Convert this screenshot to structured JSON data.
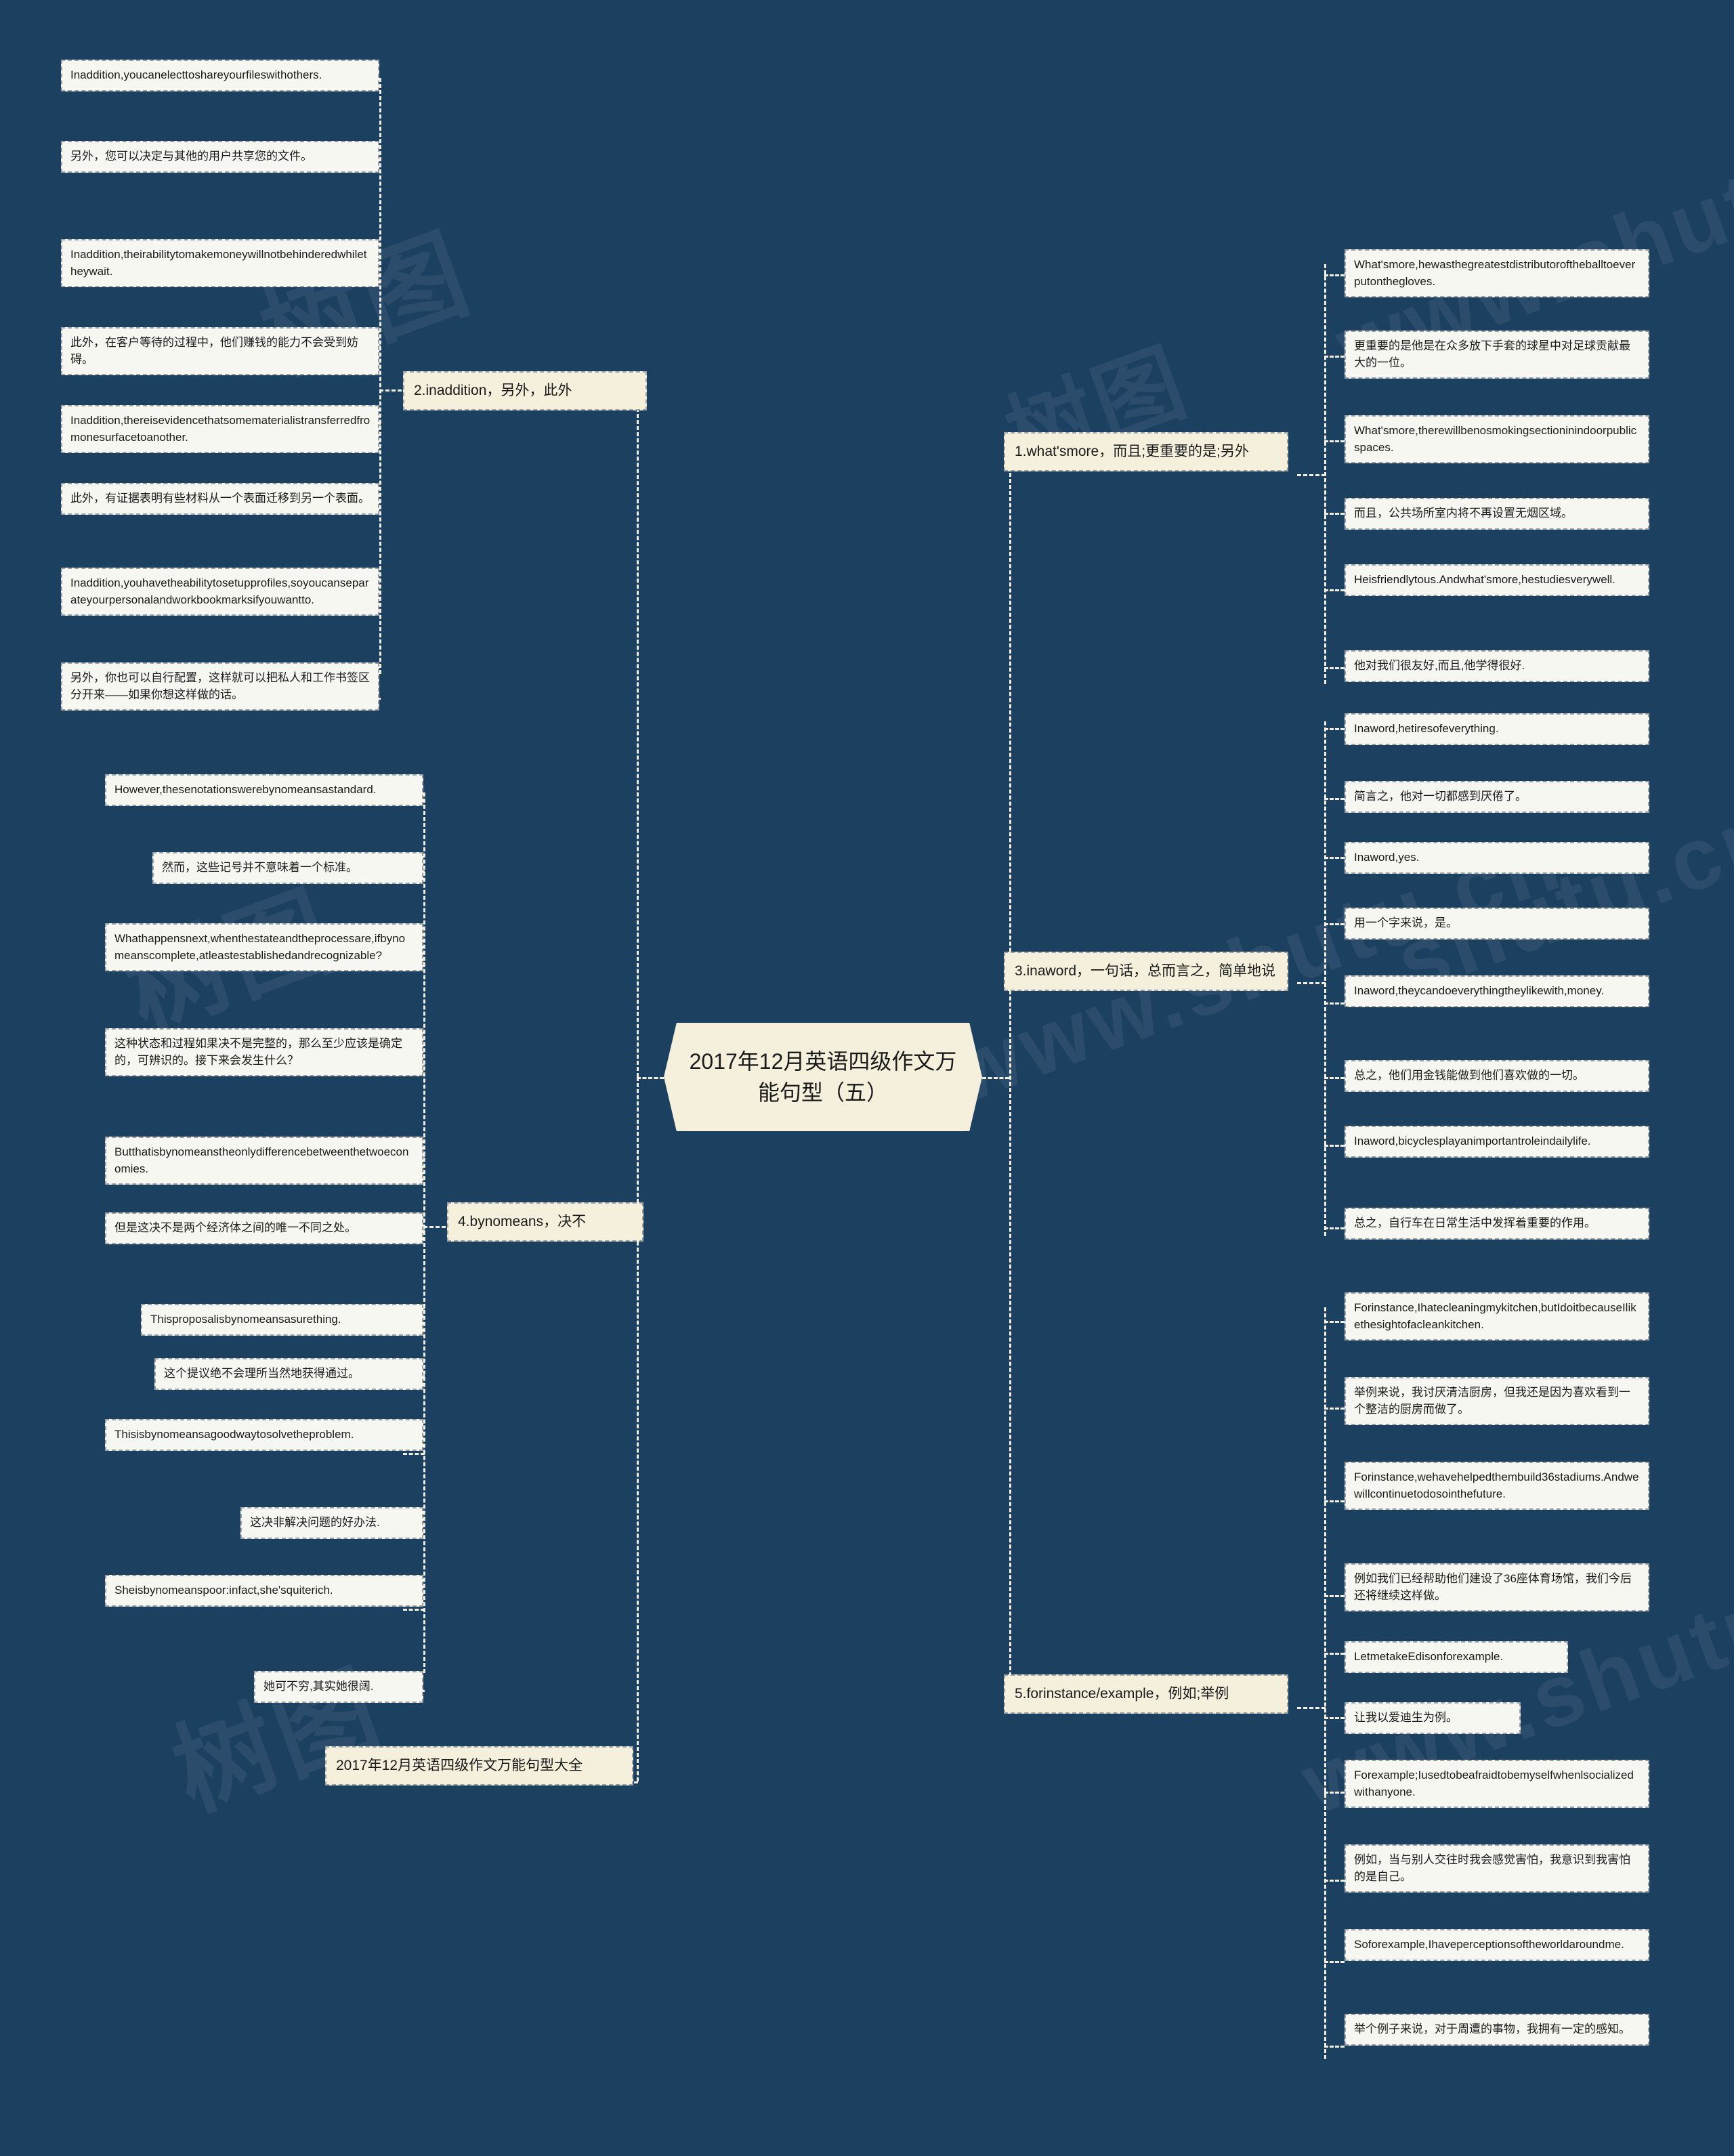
{
  "theme": {
    "background": "#1b4060",
    "node_fill": "#f7f7f2",
    "branch_fill": "#f4f0dc",
    "border": "#9aa0a6",
    "text": "#1a1a1a"
  },
  "center": {
    "title": "2017年12月英语四级作文万能句型（五）"
  },
  "watermarks": [
    "树图",
    "www.shutu.cn",
    "树图",
    "www.shutu.cn",
    "树图",
    "www.shutu.cn"
  ],
  "branches": [
    {
      "id": "whats-more",
      "label": "1.what'smore，而且;更重要的是;另外",
      "side": "right",
      "leaves": [
        "What'smore,hewasthegreatestdistributoroftheballtoeverputonthegloves.",
        "更重要的是他是在众多放下手套的球星中对足球贡献最大的一位。",
        "What'smore,therewillbenosmokingsectioninindoorpublicspaces.",
        "而且，公共场所室内将不再设置无烟区域。",
        "Heisfriendlytous.Andwhat'smore,hestudiesverywell.",
        "他对我们很友好,而且,他学得很好."
      ]
    },
    {
      "id": "in-addition",
      "label": "2.inaddition，另外，此外",
      "side": "left",
      "leaves": [
        "Inaddition,youcanelecttoshareyourfileswithothers.",
        "另外，您可以决定与其他的用户共享您的文件。",
        "Inaddition,theirabilitytomakemoneywillnotbehinderedwhiletheywait.",
        "此外，在客户等待的过程中，他们赚钱的能力不会受到妨碍。",
        "Inaddition,thereisevidencethatsomematerialistransferredfromonesurfacetoanother.",
        "此外，有证据表明有些材料从一个表面迁移到另一个表面。",
        "Inaddition,youhavetheabilitytosetupprofiles,soyoucanseparateyourpersonalandworkbookmarksifyouwantto.",
        "另外，你也可以自行配置，这样就可以把私人和工作书签区分开来——如果你想这样做的话。"
      ]
    },
    {
      "id": "in-a-word",
      "label": "3.inaword，一句话，总而言之，简单地说",
      "side": "right",
      "leaves": [
        "Inaword,hetiresofeverything.",
        "简言之，他对一切都感到厌倦了。",
        "Inaword,yes.",
        "用一个字来说，是。",
        "Inaword,theycandoeverythingtheylikewith,money.",
        "总之，他们用金钱能做到他们喜欢做的一切。",
        "Inaword,bicyclesplayanimportantroleindailylife.",
        "总之，自行车在日常生活中发挥着重要的作用。"
      ]
    },
    {
      "id": "by-no-means",
      "label": "4.bynomeans，决不",
      "side": "left",
      "leaves": [
        "However,thesenotationswerebynomeansastandard.",
        "然而，这些记号并不意味着一个标准。",
        "Whathappensnext,whenthestateandtheprocessare,ifbynomeanscomplete,atleastestablishedandrecognizable?",
        "这种状态和过程如果决不是完整的，那么至少应该是确定的，可辨识的。接下来会发生什么？",
        "Butthatisbynomeanstheonlydifferencebetweenthetwoeconomies.",
        "但是这决不是两个经济体之间的唯一不同之处。",
        "Thisproposalisbynomeansasurething.",
        "这个提议绝不会理所当然地获得通过。",
        "Thisisbynomeansagoodwaytosolvetheproblem.",
        "这决非解决问题的好办法.",
        "Sheisbynomeanspoor:infact,she'squiterich.",
        "她可不穷,其实她很阔."
      ]
    },
    {
      "id": "for-instance",
      "label": "5.forinstance/example，例如;举例",
      "side": "right",
      "leaves": [
        "Forinstance,Ihatecleaningmykitchen,butIdoitbecauseIlikethesightofacleankitchen.",
        "举例来说，我讨厌清洁厨房，但我还是因为喜欢看到一个整洁的厨房而做了。",
        "Forinstance,wehavehelpedthembuild36stadiums.Andwewillcontinuetodosointhefuture.",
        "例如我们已经帮助他们建设了36座体育场馆，我们今后还将继续这样做。",
        "LetmetakeEdisonforexample.",
        "让我以爱迪生为例。",
        "Forexample;Iusedtobeafraidtobemyselfwhenlsocializedwithanyone.",
        "例如，当与别人交往时我会感觉害怕，我意识到我害怕的是自己。",
        "Soforexample,Ihaveperceptionsoftheworldaroundme.",
        "举个例子来说，对于周遭的事物，我拥有一定的感知。"
      ]
    }
  ],
  "tail_node": {
    "label": "2017年12月英语四级作文万能句型大全"
  }
}
